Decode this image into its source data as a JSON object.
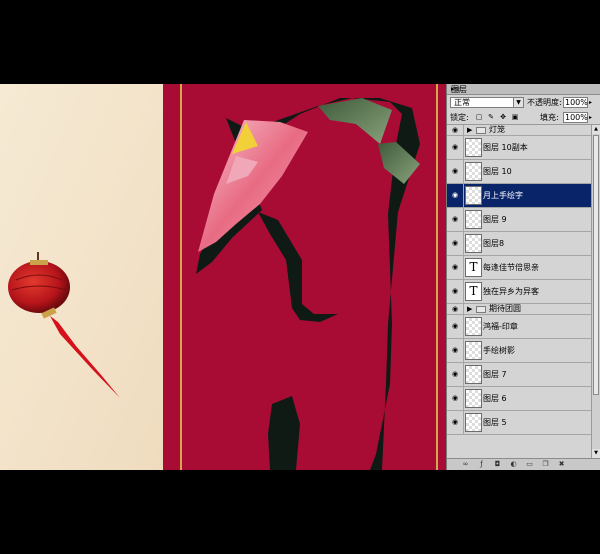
{
  "panel": {
    "tab_label": "图层",
    "menu_icon": "panel-menu-icon",
    "blend_mode": "正常",
    "opacity_label": "不透明度:",
    "opacity_value": "100%",
    "lock_label": "锁定:",
    "fill_label": "填充:",
    "fill_value": "100%"
  },
  "layers": [
    {
      "type": "group",
      "name": "灯笼",
      "visible": true
    },
    {
      "type": "pixel",
      "name": "图层 10副本",
      "visible": true
    },
    {
      "type": "pixel",
      "name": "图层 10",
      "visible": true
    },
    {
      "type": "pixel",
      "name": "月上手绘字",
      "visible": true,
      "selected": true
    },
    {
      "type": "pixel",
      "name": "图层 9",
      "visible": true
    },
    {
      "type": "pixel",
      "name": "图层8",
      "visible": true
    },
    {
      "type": "text",
      "name": "每逢佳节倍思亲",
      "visible": true
    },
    {
      "type": "text",
      "name": "独在异乡为异客",
      "visible": true
    },
    {
      "type": "group",
      "name": "期待团圆",
      "visible": true
    },
    {
      "type": "pixel",
      "name": "鸿福-印章",
      "visible": true
    },
    {
      "type": "pixel",
      "name": "手绘树影",
      "visible": true
    },
    {
      "type": "pixel",
      "name": "图层 7",
      "visible": true
    },
    {
      "type": "pixel",
      "name": "图层 6",
      "visible": true
    },
    {
      "type": "pixel",
      "name": "图层 5",
      "visible": true
    }
  ],
  "colors": {
    "paper": "#f3e5cc",
    "crimson": "#a80c35",
    "gold_line": "#d4a84a",
    "ink": "#0f1a15",
    "selected": "#0a246a"
  }
}
